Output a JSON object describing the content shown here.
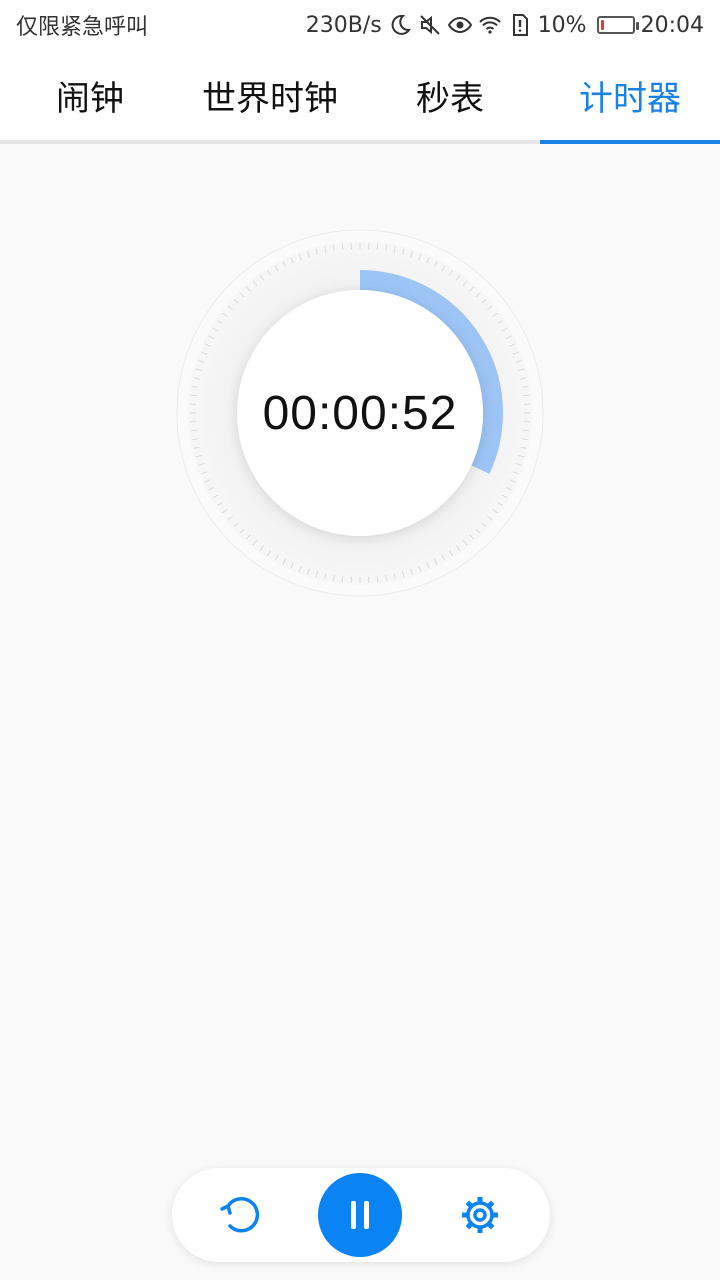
{
  "status_bar": {
    "carrier_text": "仅限紧急呼叫",
    "speed": "230B/s",
    "battery_percent": "10%",
    "battery_level": 0.1,
    "time": "20:04",
    "icons": [
      "moon-icon",
      "mute-icon",
      "eye-icon",
      "wifi-icon",
      "sim-alert-icon",
      "battery-icon"
    ]
  },
  "tabs": [
    {
      "label": "闹钟",
      "active": false
    },
    {
      "label": "世界时钟",
      "active": false
    },
    {
      "label": "秒表",
      "active": false
    },
    {
      "label": "计时器",
      "active": true
    }
  ],
  "timer": {
    "remaining": "00:00:52",
    "progress_fraction": 0.32,
    "ring_color": "#9cc4f5"
  },
  "controls": {
    "reset_icon": "reset-icon",
    "pause_icon": "pause-icon",
    "settings_icon": "gear-icon",
    "accent": "#0a84f5"
  }
}
